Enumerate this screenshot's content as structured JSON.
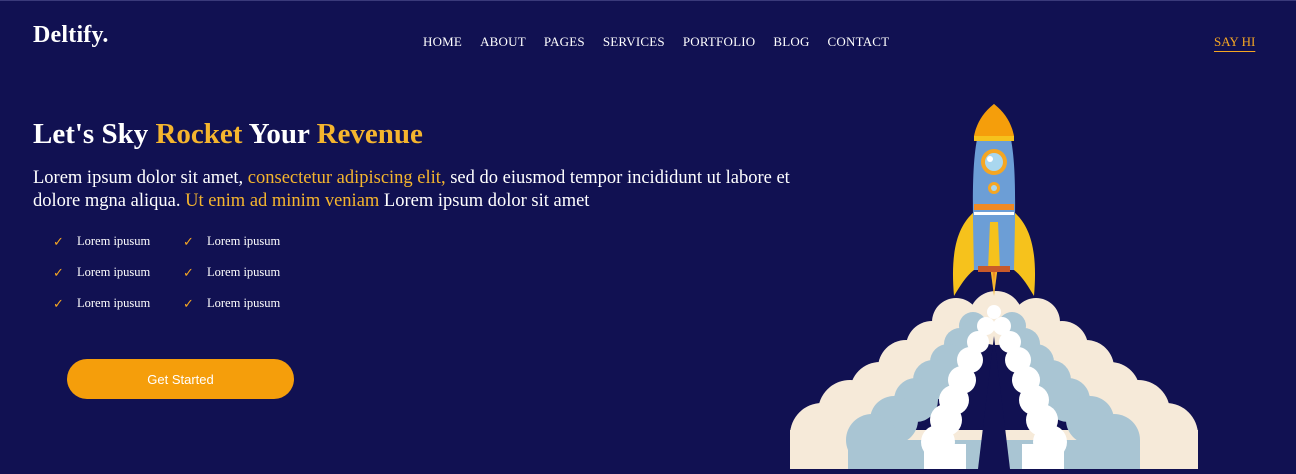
{
  "brand": {
    "logo": "Deltify."
  },
  "nav": {
    "items": [
      "HOME",
      "ABOUT",
      "PAGES",
      "SERVICES",
      "PORTFOLIO",
      "BLOG",
      "CONTACT"
    ],
    "cta": "SAY HI"
  },
  "hero": {
    "title_part1": "Let's Sky ",
    "title_part2": "Rocket",
    "title_part3": " Your ",
    "title_part4": "Revenue",
    "text_part1": "Lorem ipsum dolor sit amet, ",
    "text_part2": "consectetur adipiscing elit,",
    "text_part3": " sed do eiusmod tempor incididunt ut labore et dolore mgna aliqua. ",
    "text_part4": "Ut enim ad minim veniam",
    "text_part5": " Lorem ipsum dolor sit amet",
    "checklist": [
      "Lorem ipusum",
      "Lorem ipusum",
      "Lorem ipusum",
      "Lorem ipusum",
      "Lorem ipusum",
      "Lorem ipusum"
    ],
    "check_symbol": "✓",
    "button": "Get Started"
  },
  "colors": {
    "background": "#111152",
    "accent": "#f5a623",
    "button": "#f59e0b"
  },
  "icons": {
    "illustration": "rocket-launch-icon"
  }
}
